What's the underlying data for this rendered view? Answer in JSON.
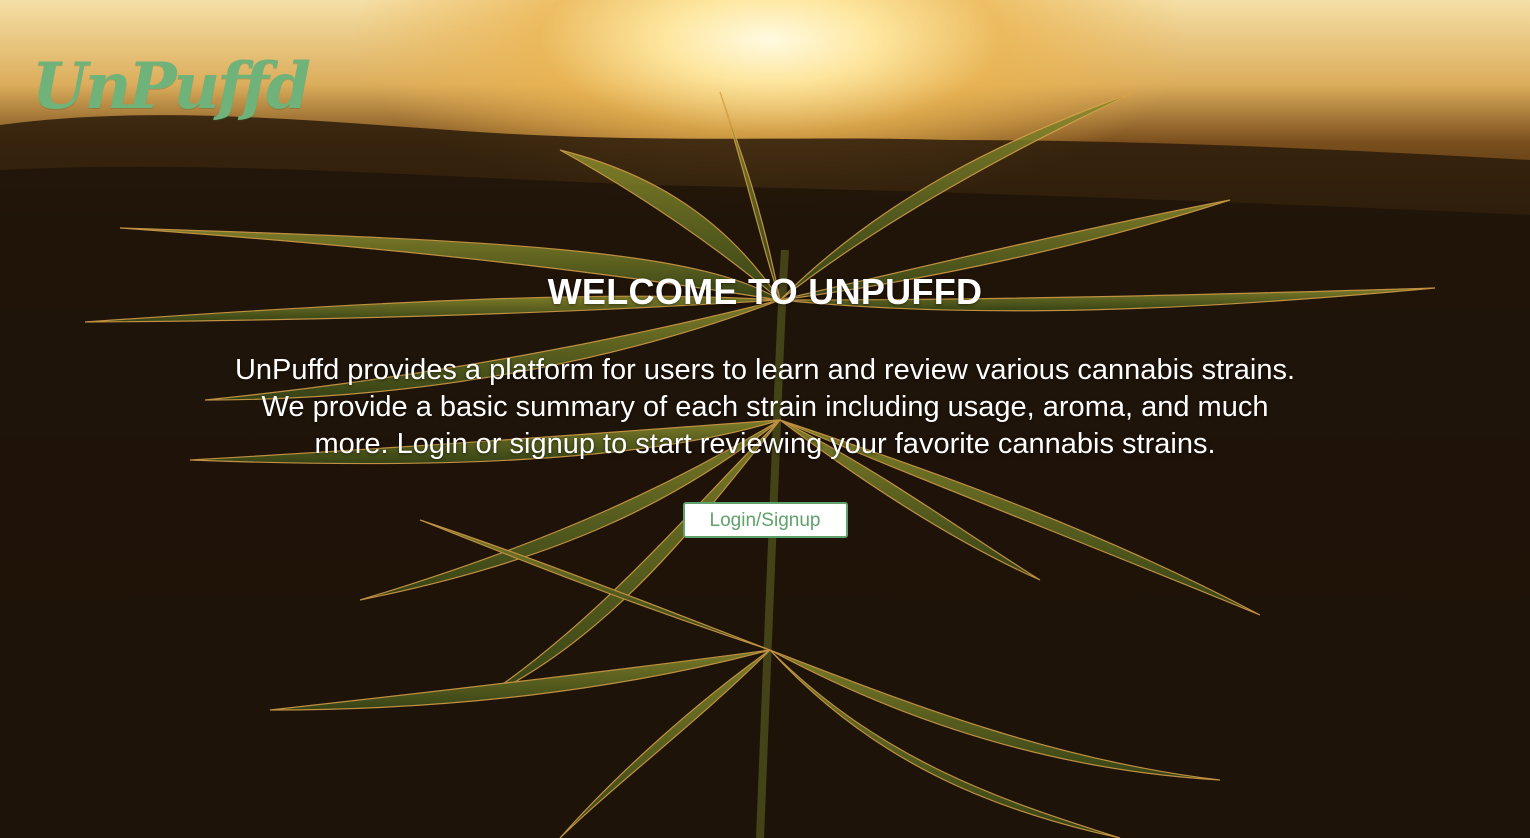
{
  "brand": {
    "logo_text": "UnPuffd",
    "logo_color": "#6fb27a"
  },
  "hero": {
    "title": "WELCOME TO UNPUFFD",
    "description": "UnPuffd provides a platform for users to learn and review various cannabis strains. We provide a basic summary of each strain including usage, aroma, and much more. Login or signup to start reviewing your favorite cannabis strains.",
    "cta_label": "Login/Signup",
    "cta_color": "#5fa26c",
    "background_image": "cannabis-plant-sunset"
  }
}
